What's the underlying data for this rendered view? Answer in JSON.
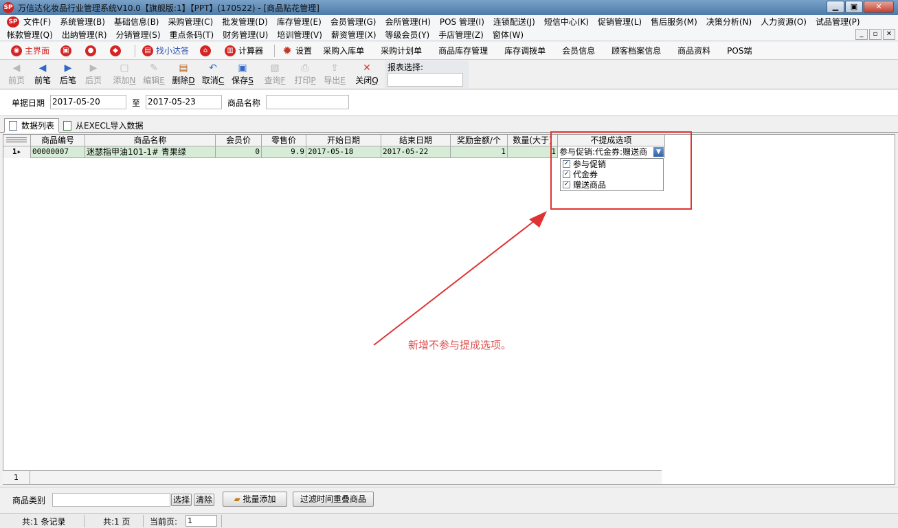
{
  "window": {
    "title": "万信达化妆品行业管理系统V10.0【旗舰版:1】【PPT】(170522) - [商品贴花管理]",
    "logo_text": "SP",
    "min": "▁",
    "max": "▣",
    "close": "✕"
  },
  "menu": {
    "row1": [
      "文件(F)",
      "系统管理(B)",
      "基础信息(B)",
      "采购管理(C)",
      "批发管理(D)",
      "库存管理(E)",
      "会员管理(G)",
      "会所管理(H)",
      "POS 管理(I)",
      "连锁配送(J)",
      "短信中心(K)",
      "促销管理(L)",
      "售后服务(M)",
      "决策分析(N)",
      "人力资源(O)",
      "试品管理(P)"
    ],
    "row2": [
      "帐款管理(Q)",
      "出纳管理(R)",
      "分销管理(S)",
      "重点条码(T)",
      "财务管理(U)",
      "培训管理(V)",
      "薪资管理(X)",
      "等级会员(Y)",
      "手店管理(Z)",
      "窗体(W)"
    ],
    "mdi": [
      "_",
      "▫",
      "✕"
    ]
  },
  "quickbar": {
    "home": "主界面",
    "find": "找小达答",
    "calc": "计算器",
    "settings": "设置",
    "links": [
      "采购入库单",
      "采购计划单",
      "商品库存管理",
      "库存调拨单",
      "会员信息",
      "顾客档案信息",
      "商品资料",
      "POS端"
    ]
  },
  "toolbar": {
    "first": "前页",
    "prev": "前笔",
    "next": "后笔",
    "last": "后页",
    "add": "添加",
    "edit": "编辑",
    "delete": "删除",
    "cancel": "取消",
    "save": "保存",
    "query": "查询",
    "print": "打印",
    "export": "导出",
    "close": "关闭",
    "add_key": "N",
    "edit_key": "E",
    "delete_key": "D",
    "cancel_key": "C",
    "save_key": "S",
    "query_key": "F",
    "print_key": "P",
    "export_key": "E",
    "close_key": "Q",
    "report_label": "报表选择:"
  },
  "filter": {
    "date_label": "单据日期",
    "date_from": "2017-05-20",
    "to_label": "至",
    "date_to": "2017-05-23",
    "name_label": "商品名称",
    "name_value": ""
  },
  "tabs": [
    "数据列表",
    "从EXECL导入数据"
  ],
  "grid": {
    "columns": [
      "商品编号",
      "商品名称",
      "会员价",
      "零售价",
      "开始日期",
      "结束日期",
      "奖励金额/个",
      "数量(大于)",
      "不提成选项"
    ],
    "row": {
      "indicator": "1▸",
      "code": "00000007",
      "name": "迷瑟指甲油101-1# 青果绿",
      "member_price": "0",
      "retail_price": "9.9",
      "start": "2017-05-18",
      "end": "2017-05-22",
      "reward": "1",
      "qty": "1",
      "option": "参与促销:代金券:赠送商"
    },
    "dropdown": [
      {
        "label": "参与促销",
        "checked": true
      },
      {
        "label": "代金券",
        "checked": true
      },
      {
        "label": "赠送商品",
        "checked": true
      }
    ],
    "footer_count": "1"
  },
  "annotation": "新增不参与提成选项。",
  "bottom": {
    "category_label": "商品类别",
    "select_btn": "选择",
    "clear_btn": "清除",
    "batch_add": "批量添加",
    "filter_btn": "过滤时间重叠商品"
  },
  "status": {
    "records": "共:1 条记录",
    "pages": "共:1 页",
    "current_label": "当前页:",
    "current_page": "1"
  }
}
